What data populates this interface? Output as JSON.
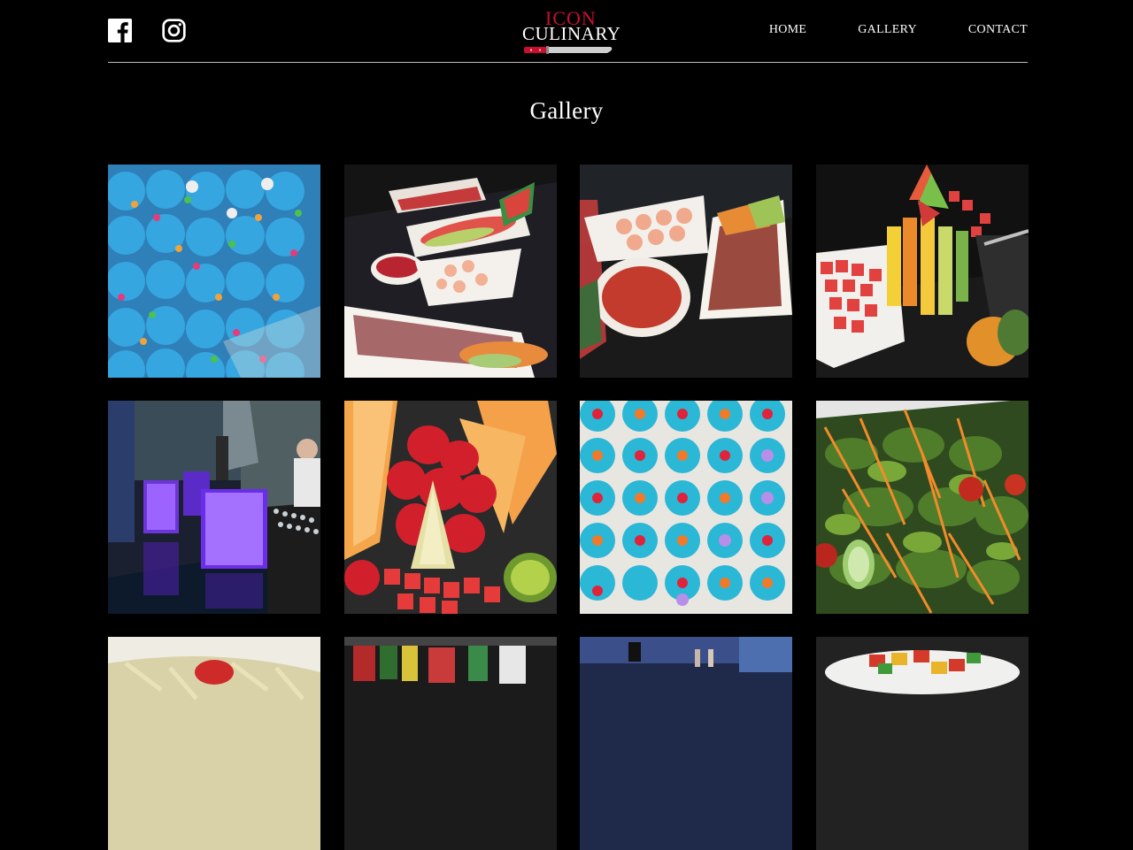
{
  "header": {
    "social": [
      {
        "name": "facebook-icon"
      },
      {
        "name": "instagram-icon"
      }
    ],
    "logo": {
      "word_top": "ICON",
      "word_bottom": "CULINARY"
    },
    "nav": [
      {
        "label": "HOME"
      },
      {
        "label": "GALLERY"
      },
      {
        "label": "CONTACT"
      }
    ]
  },
  "page_title": "Gallery",
  "colors": {
    "background": "#000000",
    "text": "#ffffff",
    "logo_red": "#c8102e",
    "divider": "#bdbdbd"
  }
}
